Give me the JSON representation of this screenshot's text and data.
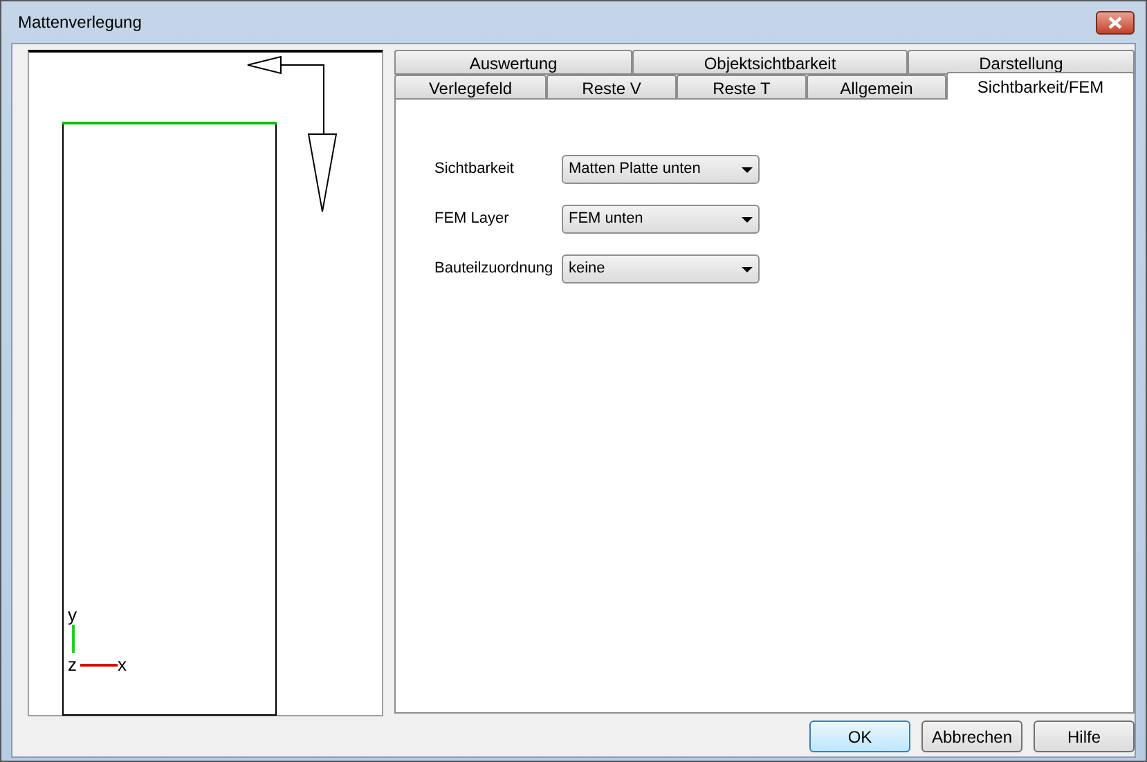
{
  "window": {
    "title": "Mattenverlegung"
  },
  "preview": {
    "axis_y": "y",
    "axis_z": "z",
    "axis_x": "x"
  },
  "tab_rows": [
    [
      {
        "label": "Auswertung",
        "selected": false
      },
      {
        "label": "Objektsichtbarkeit",
        "selected": false
      },
      {
        "label": "Darstellung",
        "selected": false
      }
    ],
    [
      {
        "label": "Verlegefeld",
        "selected": false
      },
      {
        "label": "Reste V",
        "selected": false
      },
      {
        "label": "Reste T",
        "selected": false
      },
      {
        "label": "Allgemein",
        "selected": false
      },
      {
        "label": "Sichtbarkeit/FEM",
        "selected": true
      }
    ]
  ],
  "fields": [
    {
      "label": "Sichtbarkeit",
      "value": "Matten Platte unten"
    },
    {
      "label": "FEM Layer",
      "value": "FEM unten"
    },
    {
      "label": "Bauteilzuordnung",
      "value": "keine"
    }
  ],
  "buttons": [
    {
      "label": "OK",
      "default": true
    },
    {
      "label": "Abbrechen",
      "default": false
    },
    {
      "label": "Hilfe",
      "default": false
    }
  ]
}
